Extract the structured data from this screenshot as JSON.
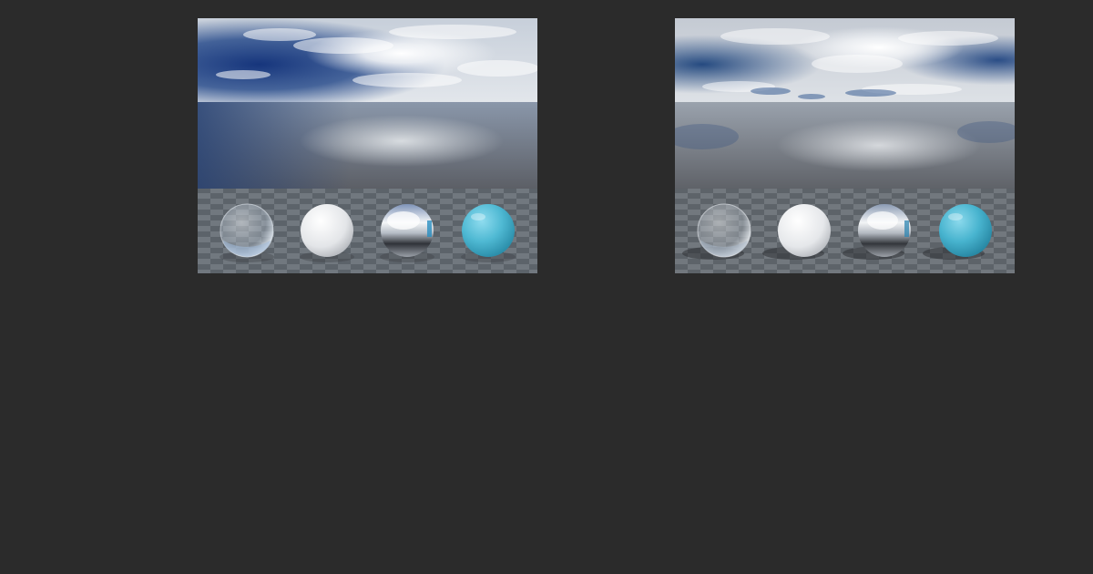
{
  "previews": [
    {
      "id": "hdri-preview-1",
      "sky_colors": {
        "zenith_blue": "#1e3f7a",
        "deep_blue": "#16357c",
        "cloud": "#dde3ea",
        "sun": "#ffffff",
        "water_top": "#8a97aa",
        "water_bottom": "#5c5f66",
        "floor_dark": "#646a72",
        "floor_light": "#7c828a"
      },
      "spheres": [
        {
          "material": "glass",
          "color": "#d7e4f0"
        },
        {
          "material": "diffuse-white",
          "color": "#e9ebee"
        },
        {
          "material": "chrome",
          "color": "#c9d1da"
        },
        {
          "material": "glossy-cyan",
          "color": "#4fb9d3"
        }
      ]
    },
    {
      "id": "hdri-preview-2",
      "sky_colors": {
        "zenith_blue": "#2a4d86",
        "deep_blue": "#254a80",
        "cloud": "#d4d8de",
        "sun": "#ffffff",
        "water_top": "#9aa2ad",
        "water_bottom": "#5f6268",
        "floor_dark": "#656a71",
        "floor_light": "#7d8289"
      },
      "spheres": [
        {
          "material": "glass",
          "color": "#dfe5ec"
        },
        {
          "material": "diffuse-white",
          "color": "#eceef0"
        },
        {
          "material": "chrome",
          "color": "#c6ccd4"
        },
        {
          "material": "glossy-cyan",
          "color": "#48b4cf"
        }
      ]
    }
  ]
}
